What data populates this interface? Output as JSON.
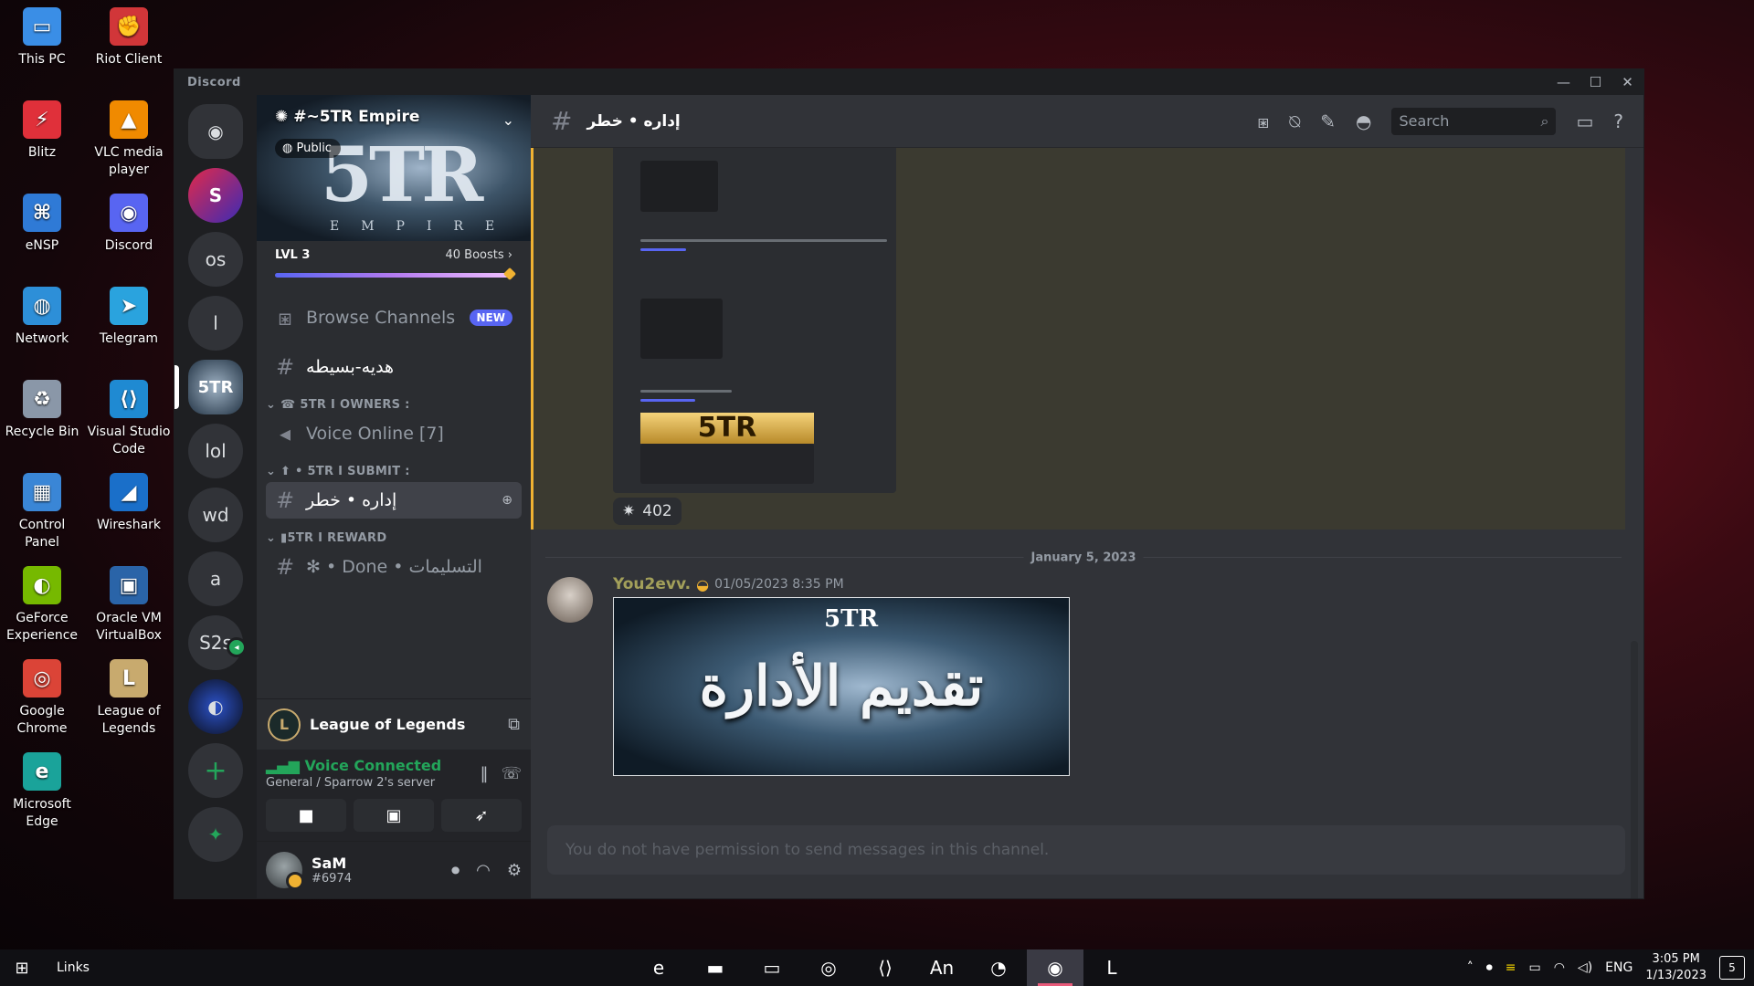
{
  "desktop": {
    "icons": [
      {
        "label": "This PC",
        "icon": "pc-icon",
        "color": "#3a8ee6",
        "glyph": "▭"
      },
      {
        "label": "Riot Client",
        "icon": "riot-icon",
        "color": "#d13639",
        "glyph": "✊"
      },
      {
        "label": "Blitz",
        "icon": "blitz-icon",
        "color": "#e0303a",
        "glyph": "⚡"
      },
      {
        "label": "VLC media player",
        "icon": "vlc-icon",
        "color": "#f08a00",
        "glyph": "▲"
      },
      {
        "label": "eNSP",
        "icon": "ensp-icon",
        "color": "#2f7ad6",
        "glyph": "⌘"
      },
      {
        "label": "Discord",
        "icon": "discord-icon",
        "color": "#5865f2",
        "glyph": "◉"
      },
      {
        "label": "Network",
        "icon": "network-icon",
        "color": "#2d8fd8",
        "glyph": "◍"
      },
      {
        "label": "Telegram",
        "icon": "telegram-icon",
        "color": "#2aa3de",
        "glyph": "➤"
      },
      {
        "label": "Recycle Bin",
        "icon": "recycle-bin-icon",
        "color": "#8a97a8",
        "glyph": "♻"
      },
      {
        "label": "Visual Studio Code",
        "icon": "vscode-icon",
        "color": "#1f8ad2",
        "glyph": "⟨⟩"
      },
      {
        "label": "Control Panel",
        "icon": "control-panel-icon",
        "color": "#3a86d6",
        "glyph": "▦"
      },
      {
        "label": "Wireshark",
        "icon": "wireshark-icon",
        "color": "#1a6fc9",
        "glyph": "◢"
      },
      {
        "label": "GeForce Experience",
        "icon": "geforce-icon",
        "color": "#76b900",
        "glyph": "◐"
      },
      {
        "label": "Oracle VM VirtualBox",
        "icon": "virtualbox-icon",
        "color": "#2a64a8",
        "glyph": "▣"
      },
      {
        "label": "Google Chrome",
        "icon": "chrome-icon",
        "color": "#db4437",
        "glyph": "◎"
      },
      {
        "label": "League of Legends",
        "icon": "league-icon",
        "color": "#c8aa6e",
        "glyph": "L"
      },
      {
        "label": "Microsoft Edge",
        "icon": "edge-icon",
        "color": "#1aa39a",
        "glyph": "e"
      }
    ]
  },
  "window": {
    "title": "Discord",
    "controls": {
      "minimize": "—",
      "maximize": "☐",
      "close": "✕"
    }
  },
  "guilds": {
    "home_glyph": "◉",
    "servers": [
      {
        "label": "S",
        "name": "guild-s"
      },
      {
        "label": "os",
        "name": "guild-os"
      },
      {
        "label": "l",
        "name": "guild-l"
      },
      {
        "label": "5TR",
        "name": "guild-5tr"
      },
      {
        "label": "lol",
        "name": "guild-lol"
      },
      {
        "label": "wd",
        "name": "guild-wd"
      },
      {
        "label": "a",
        "name": "guild-a"
      },
      {
        "label": "S2s",
        "name": "guild-s2s"
      },
      {
        "label": "◐",
        "name": "guild-sonic"
      }
    ],
    "add_glyph": "+",
    "explore_glyph": "✦"
  },
  "server": {
    "name": "#~5TR Empire",
    "visibility": "Public",
    "banner_logo": "5TR",
    "banner_sub": "EMPIRE",
    "level": "LVL 3",
    "boosts": "40 Boosts"
  },
  "channels": {
    "browse": {
      "label": "Browse Channels",
      "badge": "NEW"
    },
    "top_channel": "هديه-بسيطه",
    "categories": [
      {
        "label": "☎ 5TR  I  OWNERS :",
        "items": [
          {
            "type": "voice",
            "label": "Voice Online [7]"
          }
        ]
      },
      {
        "label": "⬆ • 5TR I SUBMIT :",
        "items": [
          {
            "type": "text",
            "label": "إداره • خطر",
            "active": true
          }
        ]
      },
      {
        "label": "▮5TR  I  REWARD",
        "items": [
          {
            "type": "text",
            "label": "✻ • Done • التسليمات"
          }
        ]
      }
    ]
  },
  "activity": {
    "game": "League of Legends"
  },
  "voice": {
    "status": "Voice Connected",
    "location": "General / Sparrow 2's server"
  },
  "user": {
    "name": "SaM",
    "tag": "#6974"
  },
  "topbar": {
    "channel_name": "إداره • خطر",
    "search_placeholder": "Search"
  },
  "messages": {
    "reaction_count": "402",
    "embed_banner": "5TR",
    "date_divider": "January 5, 2023",
    "author": "You2evv.",
    "timestamp": "01/05/2023 8:35 PM",
    "image_text": "تقديم الأدارة",
    "image_logo": "5TR"
  },
  "composer": {
    "placeholder": "You do not have permission to send messages in this channel."
  },
  "taskbar": {
    "links": "Links",
    "apps": [
      {
        "name": "taskbar-edge",
        "glyph": "e",
        "active": false
      },
      {
        "name": "taskbar-explorer",
        "glyph": "▬",
        "active": false
      },
      {
        "name": "taskbar-pc",
        "glyph": "▭",
        "active": false
      },
      {
        "name": "taskbar-chrome",
        "glyph": "◎",
        "active": false
      },
      {
        "name": "taskbar-vscode",
        "glyph": "⟨⟩",
        "active": false
      },
      {
        "name": "taskbar-animate",
        "glyph": "An",
        "active": false
      },
      {
        "name": "taskbar-clock-app",
        "glyph": "◔",
        "active": false
      },
      {
        "name": "taskbar-discord",
        "glyph": "◉",
        "active": true
      },
      {
        "name": "taskbar-league",
        "glyph": "L",
        "active": false
      }
    ],
    "lang": "ENG",
    "time": "3:05 PM",
    "date": "1/13/2023",
    "notifications": "5"
  }
}
